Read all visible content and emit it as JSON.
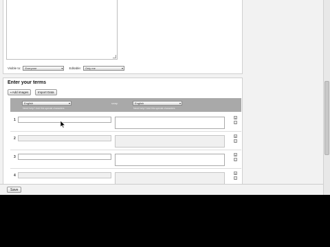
{
  "visibility": {
    "visible_label": "Visible to:",
    "visible_value": "Everyone",
    "editable_label": "Editable:",
    "editable_value": "Only me"
  },
  "terms": {
    "title": "Enter your terms",
    "add_images_label": "Add images",
    "import_data_label": "Import Data",
    "term_language": "English",
    "definition_language": "English",
    "term_language_sub": "Need help? Add this special characters",
    "definition_language_sub": "Need help? Add this special characters",
    "swap_label": "swap",
    "rows": [
      {
        "number": "1",
        "term": "",
        "definition": "",
        "active": true
      },
      {
        "number": "2",
        "term": "",
        "definition": "",
        "active": false
      },
      {
        "number": "3",
        "term": "",
        "definition": "",
        "active": true
      },
      {
        "number": "4",
        "term": "",
        "definition": "",
        "active": false
      }
    ]
  },
  "footer": {
    "save_label": "Save"
  },
  "icons": {
    "row_add": "plus-icon",
    "row_delete": "minus-icon"
  }
}
